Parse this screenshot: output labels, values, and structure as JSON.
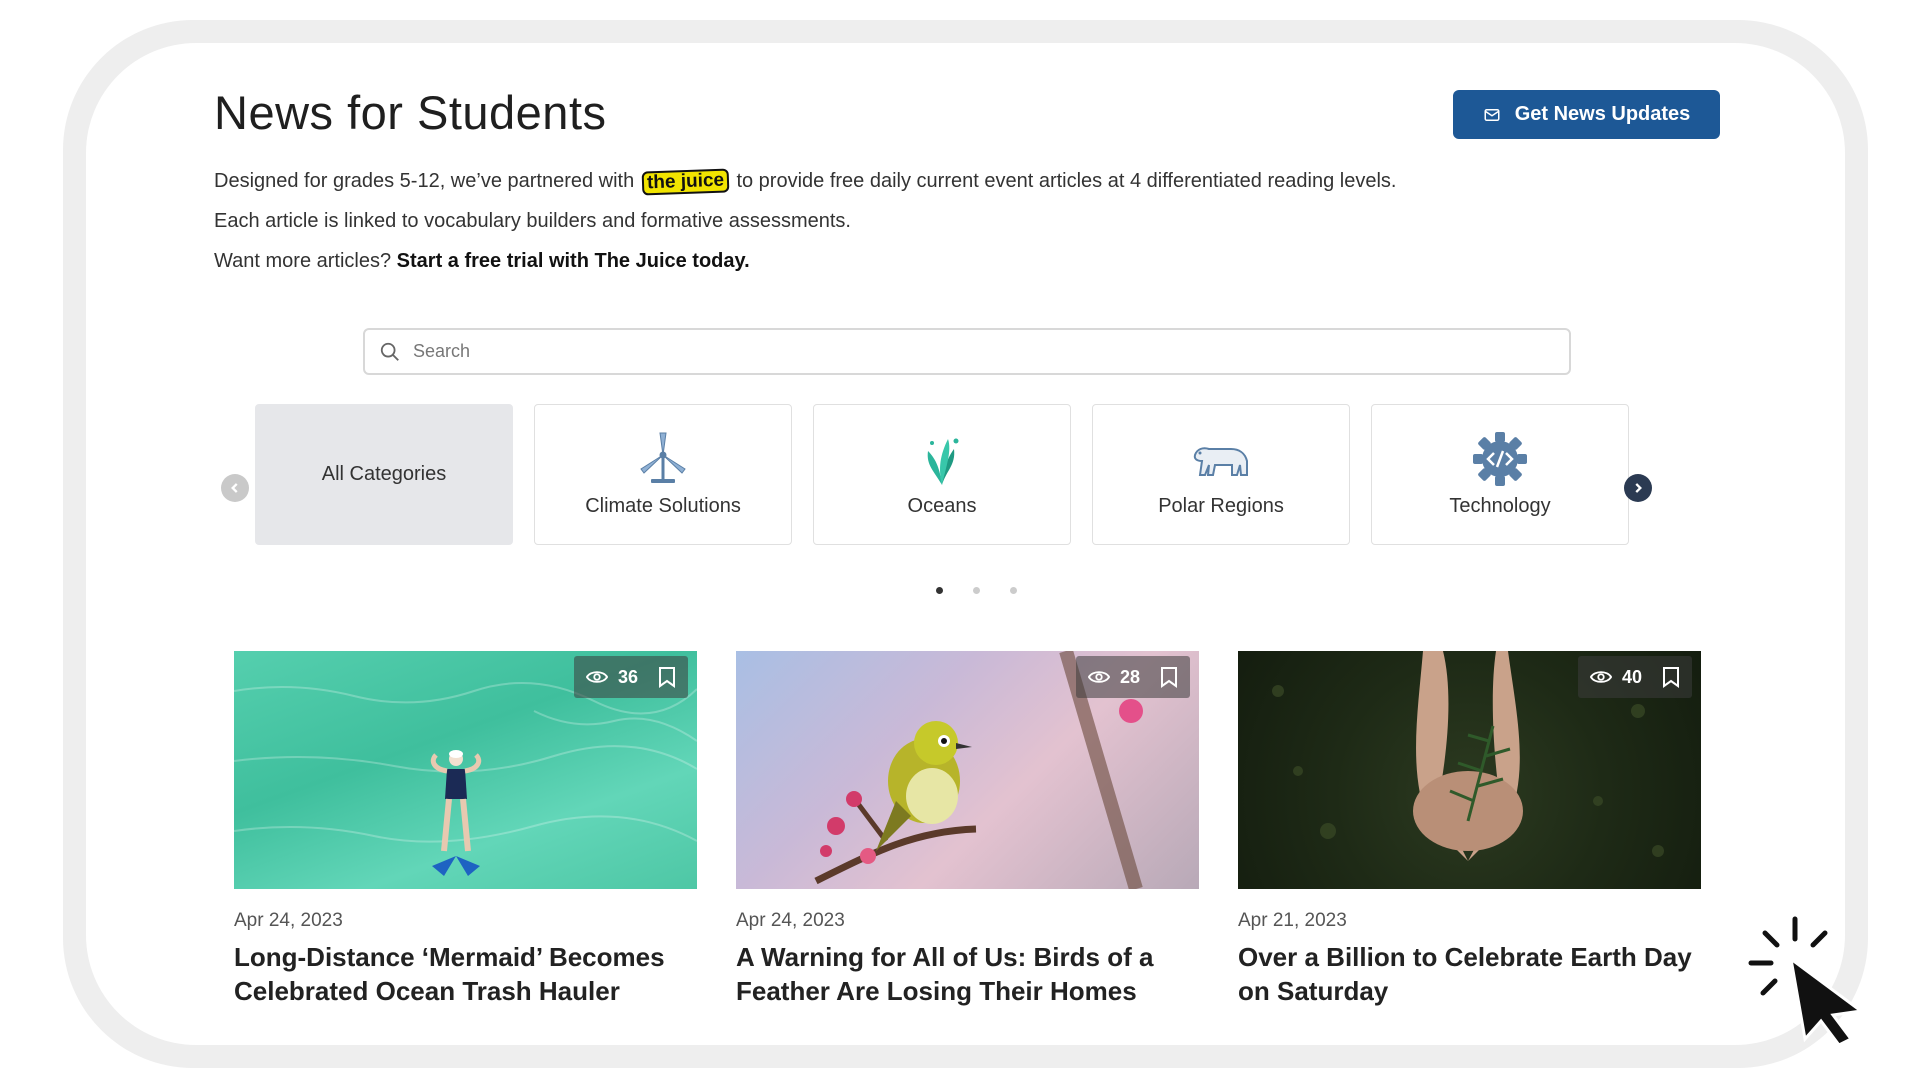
{
  "header": {
    "title": "News for Students",
    "cta_label": "Get News Updates"
  },
  "intro": {
    "line1_before": "Designed for grades 5-12, we’ve partnered with",
    "logo_text": "the juice",
    "line1_after": "to provide free daily current event articles at 4 differentiated reading levels.",
    "line2": "Each article is linked to vocabulary builders and formative assessments.",
    "line3_prefix": "Want more articles?",
    "line3_bold": "Start a free trial with The Juice today."
  },
  "search": {
    "placeholder": "Search"
  },
  "categories": [
    {
      "label": "All Categories",
      "icon": "none"
    },
    {
      "label": "Climate Solutions",
      "icon": "wind-turbine-icon"
    },
    {
      "label": "Oceans",
      "icon": "seaweed-icon"
    },
    {
      "label": "Polar Regions",
      "icon": "polar-bear-icon"
    },
    {
      "label": "Technology",
      "icon": "code-gear-icon"
    }
  ],
  "carousel": {
    "pages": 3,
    "active_page": 1
  },
  "articles": [
    {
      "date": "Apr 24, 2023",
      "title_line1": "Long-Distance ‘Mermaid’ Becomes",
      "title_line2": "Celebrated Ocean Trash Hauler",
      "views": "36"
    },
    {
      "date": "Apr 24, 2023",
      "title_line1": "A Warning for All of Us: Birds of a",
      "title_line2": "Feather Are Losing Their Homes",
      "views": "28"
    },
    {
      "date": "Apr 21, 2023",
      "title_line1": "Over a Billion to Celebrate Earth Day",
      "title_line2": "on Saturday",
      "views": "40"
    }
  ],
  "colors": {
    "primary": "#1d5896",
    "arrow_active": "#2b3a52",
    "category_icon": "#5a7fa6",
    "ocean_icon": "#2bb59b",
    "juice_yellow": "#f1e400"
  }
}
